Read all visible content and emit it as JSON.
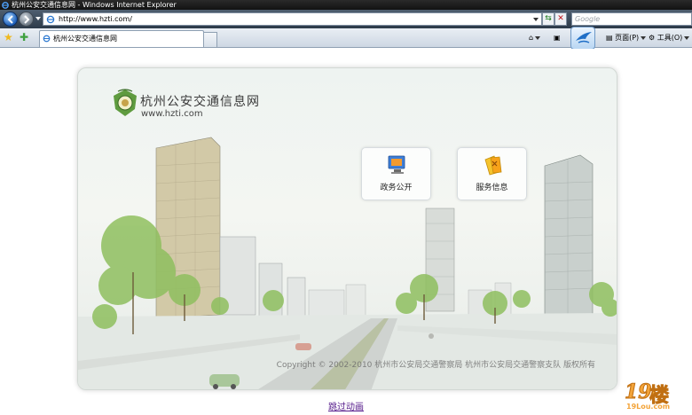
{
  "window": {
    "title": "杭州公安交通信息网 - Windows Internet Explorer"
  },
  "address_bar": {
    "url": "http://www.hzti.com/"
  },
  "search_box": {
    "placeholder": "Google"
  },
  "tab": {
    "label": "杭州公安交通信息网"
  },
  "toolbar": {
    "page_label": "页面(P)",
    "tools_label": "工具(O)"
  },
  "site": {
    "name": "杭州公安交通信息网",
    "url": "www.hzti.com",
    "tiles": [
      {
        "label": "政务公开",
        "icon": "monitor-icon"
      },
      {
        "label": "服务信息",
        "icon": "info-folder-icon"
      }
    ],
    "copyright": "Copyright © 2002-2010 杭州市公安局交通警察局 杭州市公安局交通警察支队  版权所有",
    "skip_link": "跳过动画"
  },
  "watermark": {
    "number": "19",
    "char": "楼",
    "url": "19Lou.com"
  },
  "colors": {
    "link": "#551a8b",
    "tile_bg": "#ffffff",
    "panel_bg": "#eef3f1",
    "watermark": "#f3a43a"
  }
}
